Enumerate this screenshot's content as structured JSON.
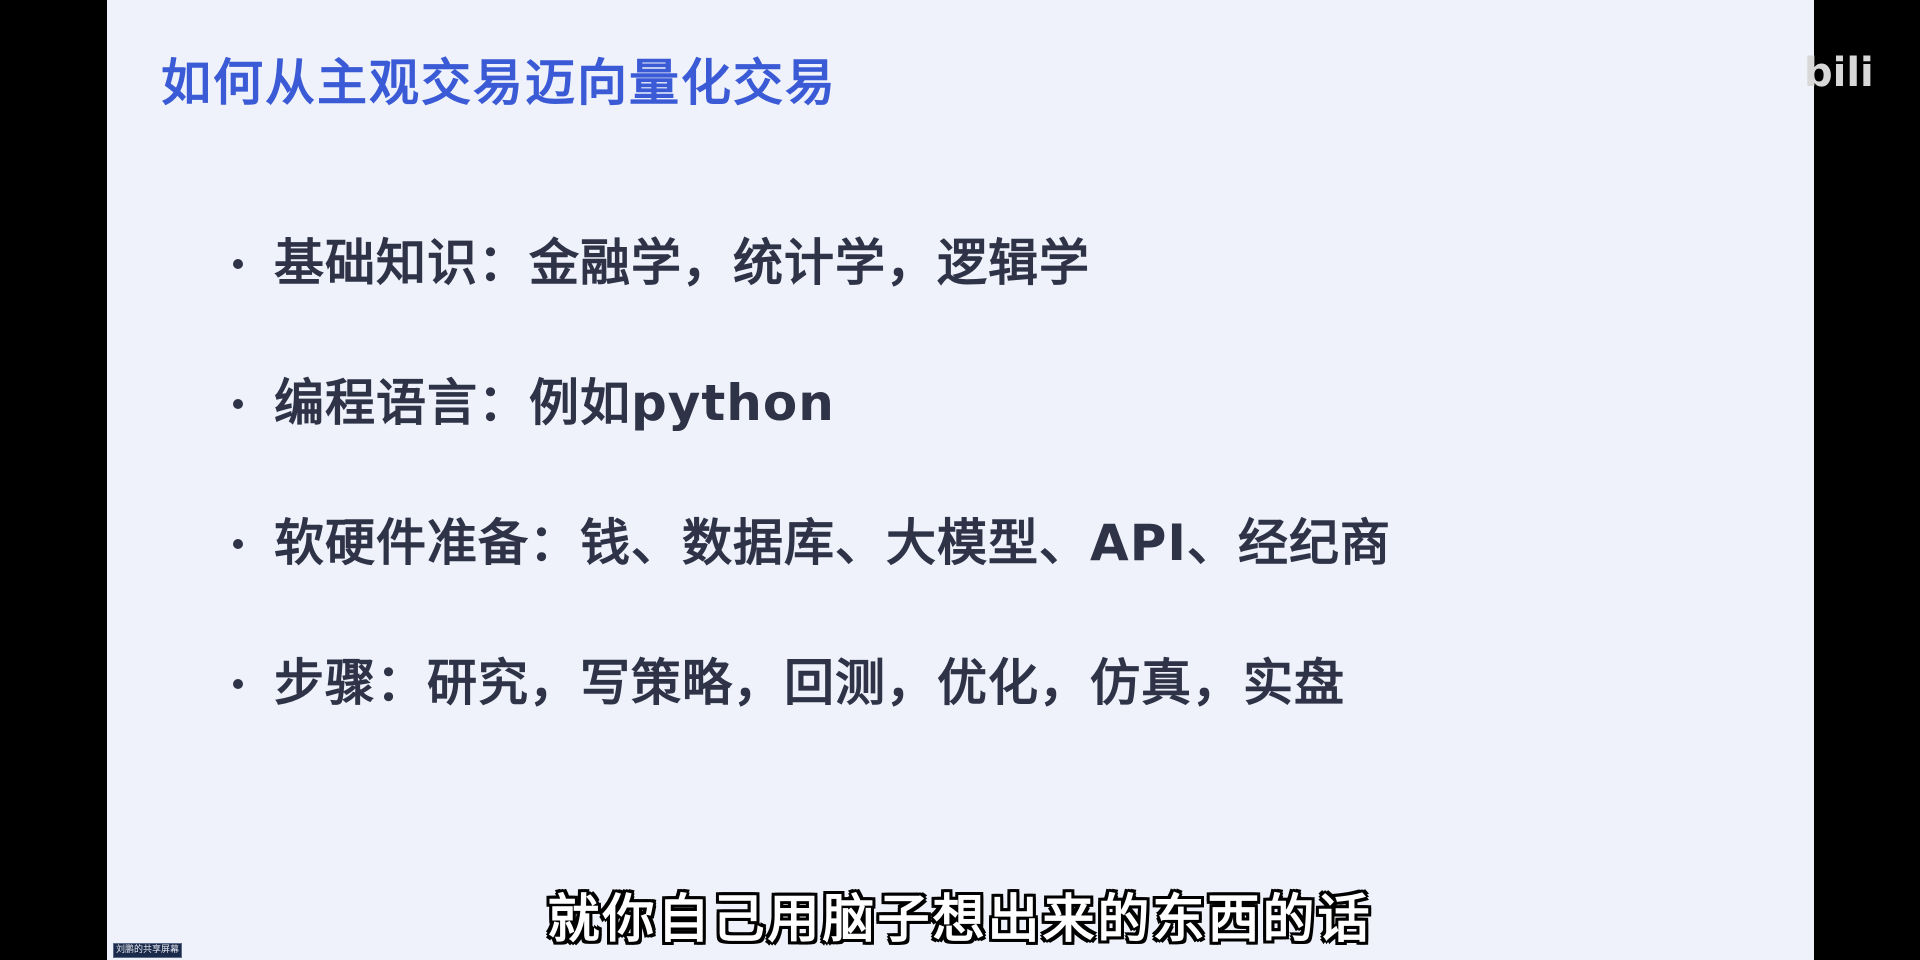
{
  "slide": {
    "title": "如何从主观交易迈向量化交易",
    "bullets": [
      "基础知识：金融学，统计学，逻辑学",
      "编程语言：例如python",
      "软硬件准备：钱、数据库、大模型、API、经纪商",
      "步骤：研究，写策略，回测，优化，仿真，实盘"
    ]
  },
  "video_overlay": {
    "watermark": "bili",
    "subtitle": "就你自己用脑子想出来的东西的话",
    "share_badge": "刘鹏的共享屏幕"
  },
  "colors": {
    "background": "#000000",
    "slide_background": "#eff2fa",
    "title": "#3b5ad6",
    "body_text": "#2e3347",
    "subtitle_text": "#ffffff"
  }
}
